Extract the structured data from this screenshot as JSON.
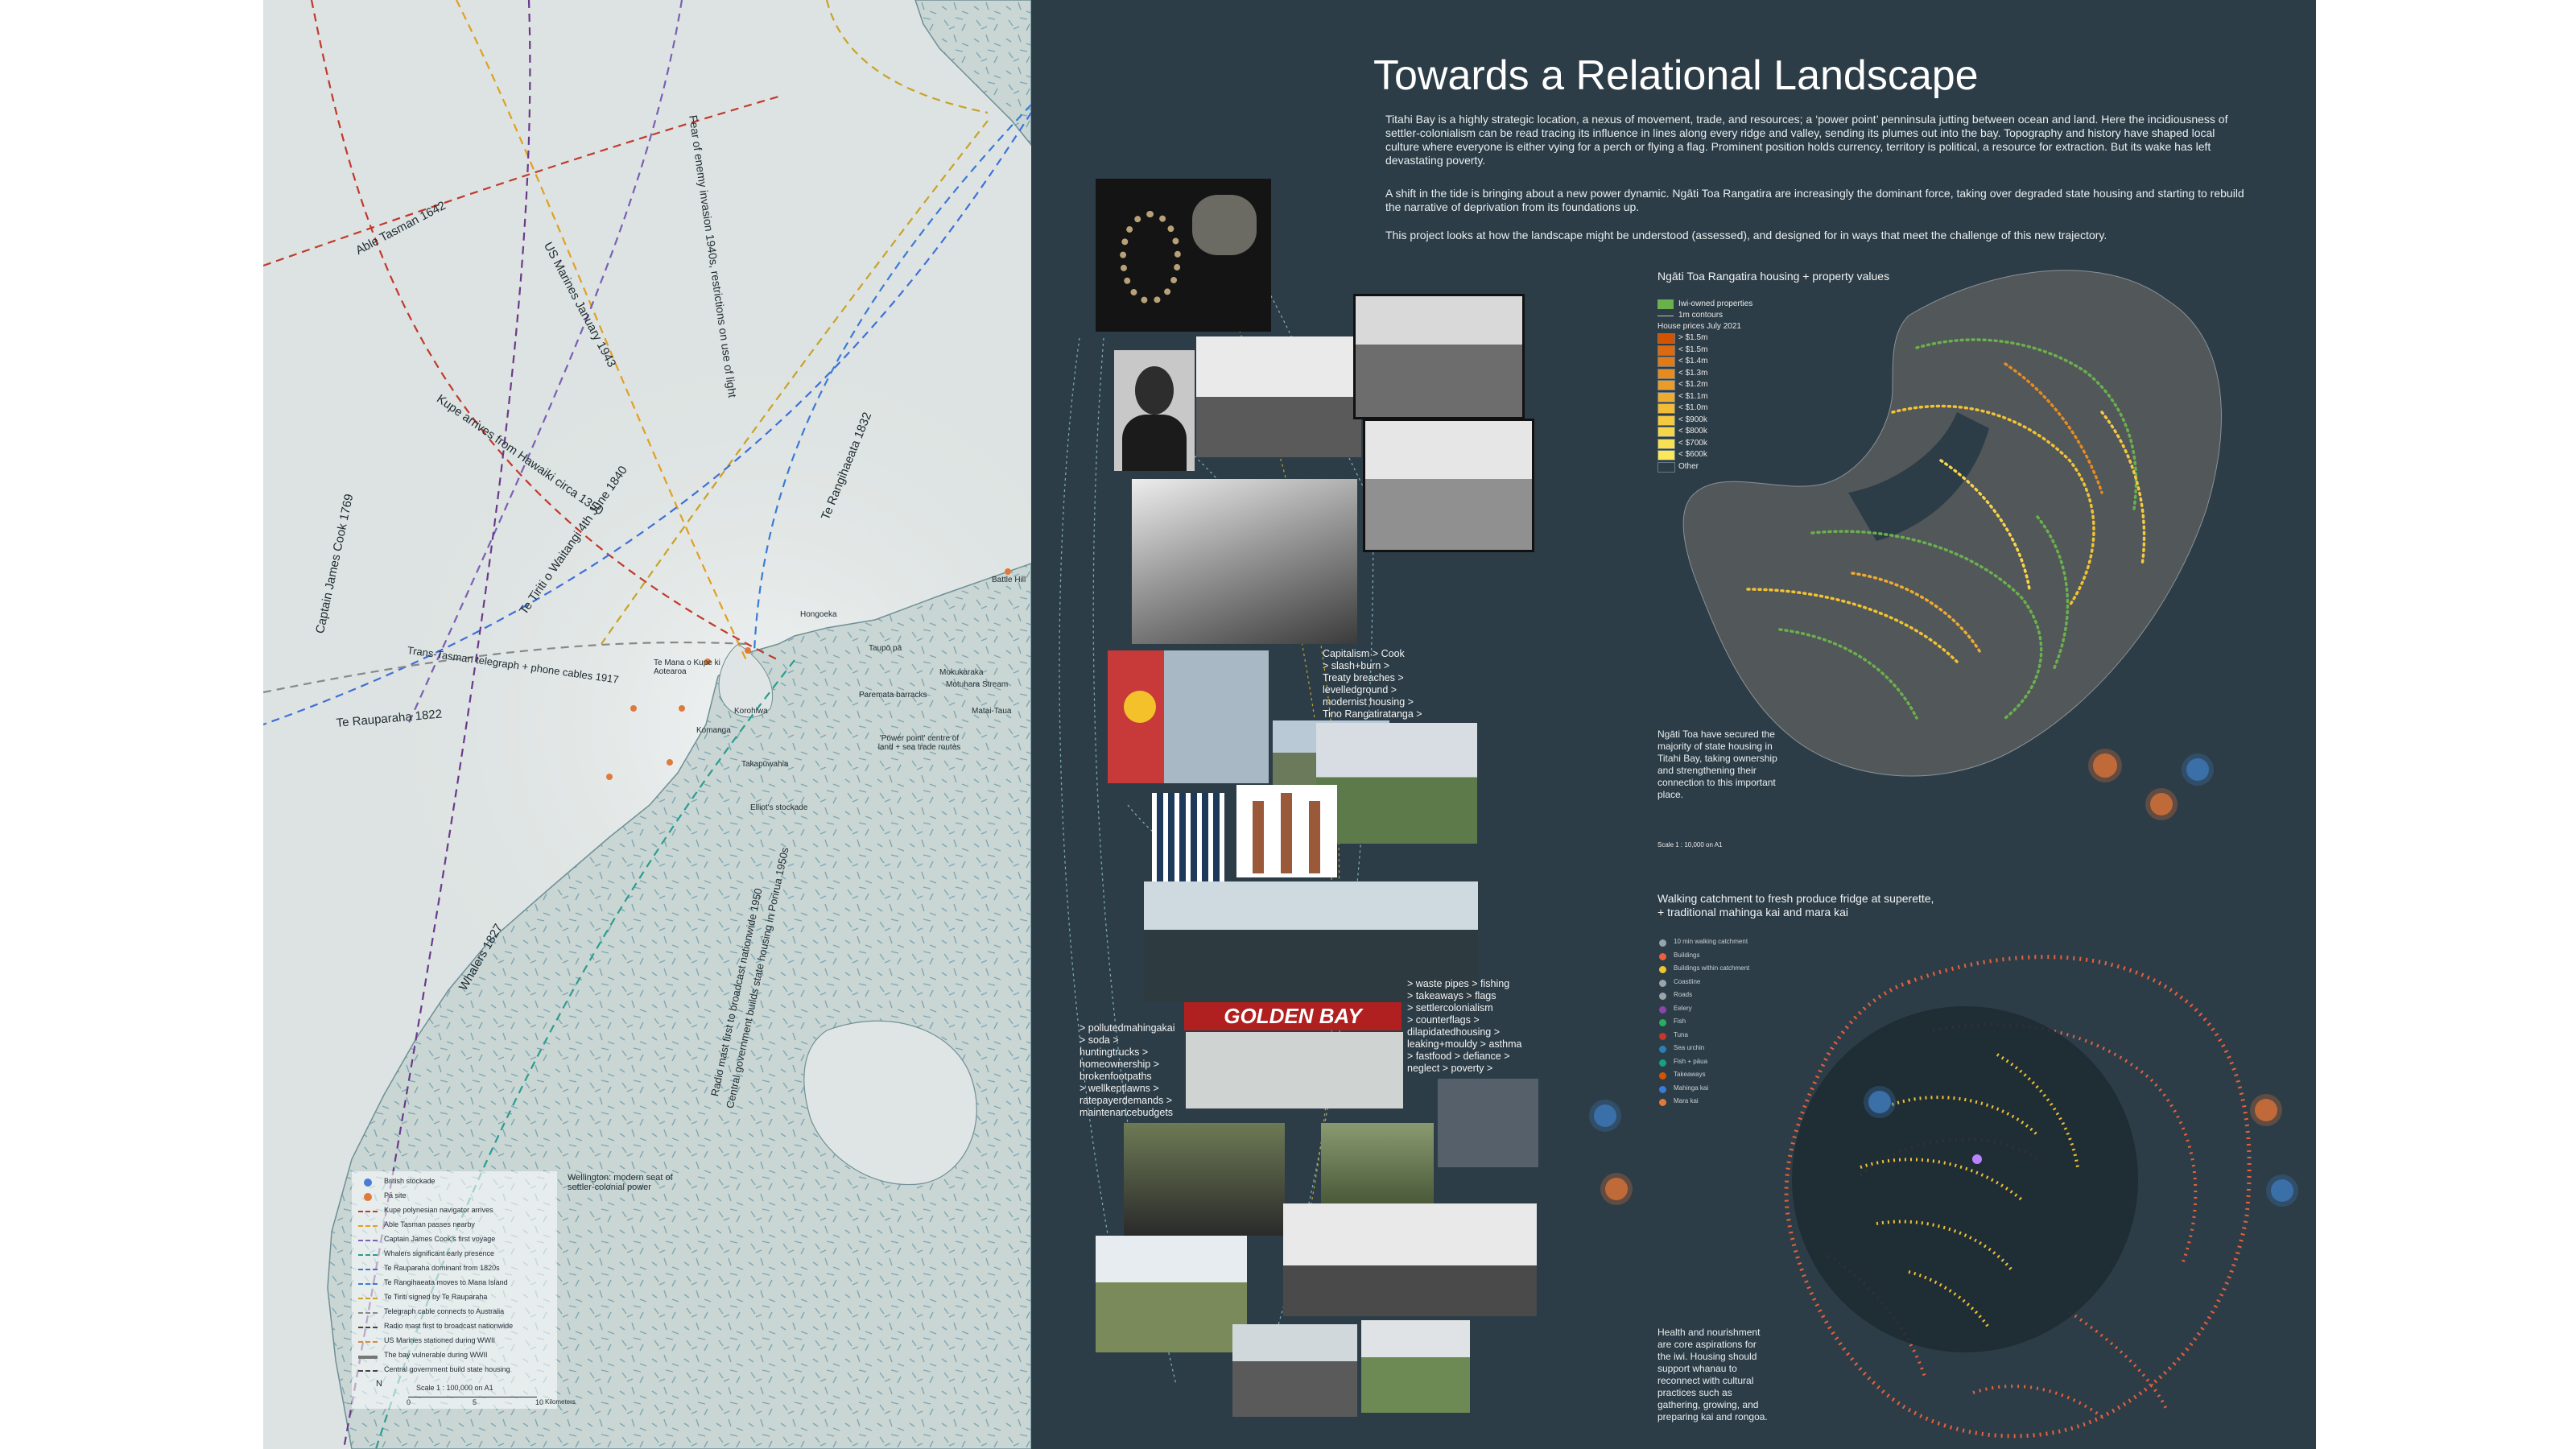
{
  "map": {
    "routes": [
      {
        "label": "Able Tasman 1642",
        "color": "#c0392b"
      },
      {
        "label": "US Marines January 1943",
        "color": "#7a3b2e"
      },
      {
        "label": "Fear of enemy invasion 1940s, restrictions on use of light",
        "color": "#2d2d2d"
      },
      {
        "label": "Kupe arrives from Hawaiki circa 1350",
        "color": "#6a3a8a"
      },
      {
        "label": "Te Tiriti o Waitangi 4th June 1840",
        "color": "#c9a227"
      },
      {
        "label": "Captain James Cook 1769",
        "color": "#7a5fb5"
      },
      {
        "label": "Te Rangihaeata 1832",
        "color": "#3a7bd5"
      },
      {
        "label": "Trans-Tasman telegraph + phone cables 1917",
        "color": "#888888"
      },
      {
        "label": "Te Rauparaha 1822",
        "color": "#3f6fd8"
      },
      {
        "label": "Whalers 1827",
        "color": "#2a9d8f"
      },
      {
        "label": "Radio mast first to broadcast nationwide 1950",
        "color": "#444444"
      },
      {
        "label": "Central government builds state housing in Porirua 1950s",
        "color": "#444444"
      }
    ],
    "places": [
      {
        "label": "Battle Hill"
      },
      {
        "label": "Hongoeka"
      },
      {
        "label": "Taupō pā"
      },
      {
        "label": "Te Mana o Kupe ki Aotearoa"
      },
      {
        "label": "Mokukaraka"
      },
      {
        "label": "Paremata barracks"
      },
      {
        "label": "Motuhara Stream"
      },
      {
        "label": "Matai-Taua"
      },
      {
        "label": "Korohiwa"
      },
      {
        "label": "Komanga"
      },
      {
        "label": "Takapūwahia"
      },
      {
        "label": "'Power point' centre of land + sea trade routes"
      },
      {
        "label": "Elliot's stockade"
      },
      {
        "label": "Wellington: modern seat of settler-colonial power"
      }
    ],
    "legend": {
      "items": [
        {
          "label": "British stockade",
          "color": "#4a7bd5"
        },
        {
          "label": "Pā site",
          "color": "#e07a3a"
        },
        {
          "label": "Kupe polynesian navigator arrives",
          "color": "#c0392b"
        },
        {
          "label": "Able Tasman passes nearby",
          "color": "#e0a020"
        },
        {
          "label": "Captain James Cook's first voyage",
          "color": "#7a5fb5"
        },
        {
          "label": "Whalers significant early presence",
          "color": "#2a9d8f"
        },
        {
          "label": "Te Rauparaha dominant from 1820s",
          "color": "#3f6fd8"
        },
        {
          "label": "Te Rangihaeata moves to Mana Island",
          "color": "#3a7bd5"
        },
        {
          "label": "Te Tiriti signed by Te Rauparaha",
          "color": "#c9a227"
        },
        {
          "label": "Telegraph cable connects to Australia",
          "color": "#888888"
        },
        {
          "label": "Radio mast first to broadcast nationwide",
          "color": "#444444"
        },
        {
          "label": "US Marines stationed during WWII",
          "color": "#d98a3a"
        },
        {
          "label": "The bay vulnerable during WWII",
          "color": "#777777"
        },
        {
          "label": "Central government build state housing",
          "color": "#444444"
        }
      ],
      "north": "N",
      "scale": "Scale 1 : 100,000 on A1",
      "scale_ticks": [
        "0",
        "5",
        "10"
      ],
      "scale_unit": "Kilometers"
    }
  },
  "panel": {
    "title": "Towards a Relational Landscape",
    "intro": [
      "Titahi Bay is a highly strategic location, a nexus of movement, trade, and resources; a ‘power point’ penninsula jutting between ocean and land. Here the incidiousness of settler-colonialism can be read tracing its influence in lines along every ridge and valley, sending its plumes out into the bay. Topography and history have shaped local culture where everyone is either vying for a perch or flying a flag. Prominent position holds currency, territory is political, a resource for extraction. But its wake has left devastating poverty.",
      "A shift in the tide is bringing about a new power dynamic. Ngāti Toa Rangatira are increasingly the dominant force, taking over degraded state housing and starting to rebuild the narrative of deprivation from its foundations up.",
      "This project looks at how the landscape might be understood (assessed), and designed for in ways that meet the challenge of this new trajectory."
    ],
    "notes": {
      "capitalism": "Capitalism > Cook\n> slash+burn >\nTreaty breaches >\nlevelledground >\nmodernist housing >\nTino Rangatiratanga >",
      "waste": "> waste pipes > fishing\n> takeaways > flags\n> settlercolonialism\n> counterflags >\ndilapidatedhousing >\nleaking+mouldy > asthma\n> fastfood > defiance >\nneglect > poverty >",
      "polluted": "> pollutedmahingakai\n> soda >\nhuntingtrucks >\nhomeownership >\nbrokenfootpaths\n> wellkeptlawns >\nratepayerdemands >\nmaintenancebudgets",
      "sign": "GOLDEN BAY TAKEAWAY"
    },
    "map1": {
      "title": "Ngāti Toa Rangatira housing + property values",
      "legend": [
        {
          "label": "Iwi-owned properties",
          "color": "#6ab04c"
        },
        {
          "label": "1m contours",
          "color": "#c0c4c6"
        },
        {
          "label": "House prices July 2021",
          "color": ""
        },
        {
          "label": "> $1.5m",
          "color": "#d35400"
        },
        {
          "label": "< $1.5m",
          "color": "#dc6a10"
        },
        {
          "label": "< $1.4m",
          "color": "#e07b18"
        },
        {
          "label": "< $1.3m",
          "color": "#e58b20"
        },
        {
          "label": "< $1.2m",
          "color": "#ea9b28"
        },
        {
          "label": "< $1.1m",
          "color": "#eeab30"
        },
        {
          "label": "< $1.0m",
          "color": "#f2bb38"
        },
        {
          "label": "< $900k",
          "color": "#f5c940"
        },
        {
          "label": "< $800k",
          "color": "#f7d548"
        },
        {
          "label": "< $700k",
          "color": "#f9e050"
        },
        {
          "label": "< $600k",
          "color": "#fbe858"
        },
        {
          "label": "Other",
          "color": "#2d3d47"
        }
      ],
      "caption": "Ngāti Toa have secured the majority of state housing in Titahi Bay, taking ownership and strengthening their connection to this important place.",
      "scale": "Scale 1 : 10,000 on A1"
    },
    "map2": {
      "title": "Walking catchment to fresh produce fridge at superette,\n+ traditional mahinga kai and mara kai",
      "legend": [
        {
          "label": "10 min walking catchment",
          "color": "#9aa4aa"
        },
        {
          "label": "Buildings",
          "color": "#e8603c"
        },
        {
          "label": "Buildings within catchment",
          "color": "#f1c232"
        },
        {
          "label": "Coastline",
          "color": "#9aa4aa"
        },
        {
          "label": "Roads",
          "color": "#9aa4aa"
        },
        {
          "label": "Eelery",
          "color": "#8e44ad"
        },
        {
          "label": "Fish",
          "color": "#27ae60"
        },
        {
          "label": "Tuna",
          "color": "#c0392b"
        },
        {
          "label": "Sea urchin",
          "color": "#2980b9"
        },
        {
          "label": "Fish + pāua",
          "color": "#16a085"
        },
        {
          "label": "Takeaways",
          "color": "#d35400"
        },
        {
          "label": "Mahinga kai",
          "color": "#3a7bd5"
        },
        {
          "label": "Mara kai",
          "color": "#e07a3a"
        }
      ],
      "caption": "Health and nourishment\nare core aspirations for\nthe iwi. Housing should\nsupport whanau to\nreconnect with cultural\npractices such as\ngathering, growing, and\npreparing kai and rongoa."
    }
  },
  "colors": {
    "panel_bg": "#2d3d47",
    "map_bg": "#dde3e2",
    "land": "#c8d4d2",
    "accent_green": "#6ab04c",
    "accent_orange": "#e8603c",
    "accent_yellow": "#f1c232"
  }
}
